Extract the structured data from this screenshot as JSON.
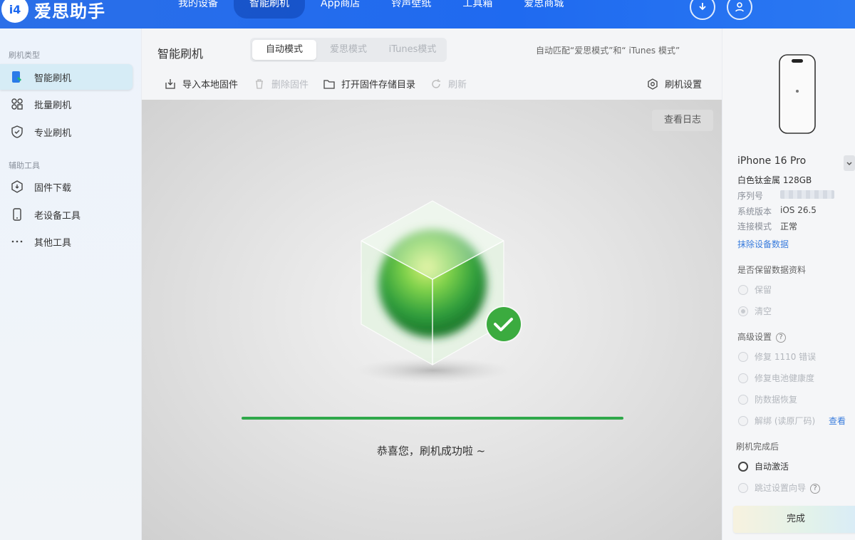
{
  "app": {
    "brand_logo_text": "i4",
    "brand_name": "爱思助手"
  },
  "topnav": [
    "我的设备",
    "智能刷机",
    "App商店",
    "铃声壁纸",
    "工具箱",
    "爱思商城"
  ],
  "sidebar": {
    "group1": "刷机类型",
    "items1": [
      "智能刷机",
      "批量刷机",
      "专业刷机"
    ],
    "group2": "辅助工具",
    "items2": [
      "固件下载",
      "老设备工具",
      "其他工具"
    ]
  },
  "main": {
    "title": "智能刷机",
    "modes": [
      "自动模式",
      "爱思模式",
      "iTunes模式"
    ],
    "mode_note": "自动匹配“爱思模式”和“ iTunes 模式”",
    "toolbar": {
      "import": "导入本地固件",
      "delete": "删除固件",
      "open_dir": "打开固件存储目录",
      "refresh": "刷新",
      "settings": "刷机设置"
    },
    "log_button": "查看日志",
    "progress": 1.0,
    "success": "恭喜您，刷机成功啦 ~"
  },
  "device": {
    "name": "iPhone 16 Pro",
    "color_storage": "白色钛金属 128GB",
    "serial_label": "序列号",
    "version_label": "系统版本",
    "version": "iOS 26.5",
    "conn_label": "连接模式",
    "conn": "正常",
    "erase_link": "抹除设备数据"
  },
  "options": {
    "keep_title": "是否保留数据资料",
    "keep": "保留",
    "clear": "清空",
    "advanced_title": "高级设置",
    "adv": [
      "修复 1110 错误",
      "修复电池健康度",
      "防数据恢复",
      "解绑 (读原厂码)"
    ],
    "view_link": "查看",
    "after_title": "刷机完成后",
    "auto_activate": "自动激活",
    "skip_setup": "跳过设置向导",
    "done": "完成"
  },
  "colors": {
    "accent": "#1f6af0",
    "success": "#2fa84a",
    "link": "#3b7ddd"
  }
}
